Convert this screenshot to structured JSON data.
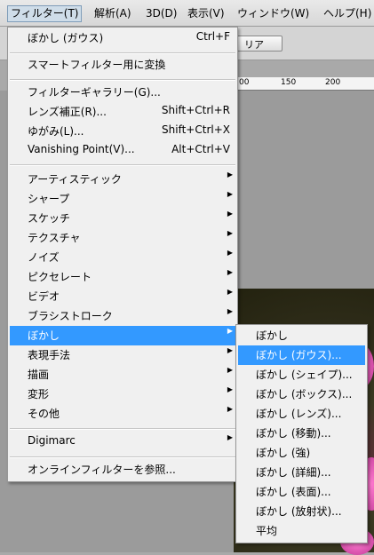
{
  "menubar": {
    "items": [
      "フィルター(T)",
      "解析(A)",
      "3D(D)",
      "表示(V)",
      "ウィンドウ(W)",
      "ヘルプ(H)"
    ]
  },
  "background": {
    "button_label": "リア",
    "ruler": [
      "00",
      "150",
      "200"
    ]
  },
  "filter_menu": {
    "last_filter": {
      "label": "ぼかし (ガウス)",
      "shortcut": "Ctrl+F"
    },
    "smart_filter": "スマートフィルター用に変換",
    "gallery": "フィルターギャラリー(G)...",
    "lens": {
      "label": "レンズ補正(R)...",
      "shortcut": "Shift+Ctrl+R"
    },
    "liquify": {
      "label": "ゆがみ(L)...",
      "shortcut": "Shift+Ctrl+X"
    },
    "vanishing": {
      "label": "Vanishing Point(V)...",
      "shortcut": "Alt+Ctrl+V"
    },
    "categories": [
      "アーティスティック",
      "シャープ",
      "スケッチ",
      "テクスチャ",
      "ノイズ",
      "ピクセレート",
      "ビデオ",
      "ブラシストローク",
      "ぼかし",
      "表現手法",
      "描画",
      "変形",
      "その他"
    ],
    "digimarc": "Digimarc",
    "browse": "オンラインフィルターを参照..."
  },
  "blur_submenu": {
    "items": [
      "ぼかし",
      "ぼかし (ガウス)...",
      "ぼかし (シェイプ)...",
      "ぼかし (ボックス)...",
      "ぼかし (レンズ)...",
      "ぼかし (移動)...",
      "ぼかし (強)",
      "ぼかし (詳細)...",
      "ぼかし (表面)...",
      "ぼかし (放射状)...",
      "平均"
    ]
  },
  "state": {
    "active_menu": "フィルター(T)",
    "highlighted_category": "ぼかし",
    "highlighted_submenu_item": "ぼかし (ガウス)..."
  }
}
